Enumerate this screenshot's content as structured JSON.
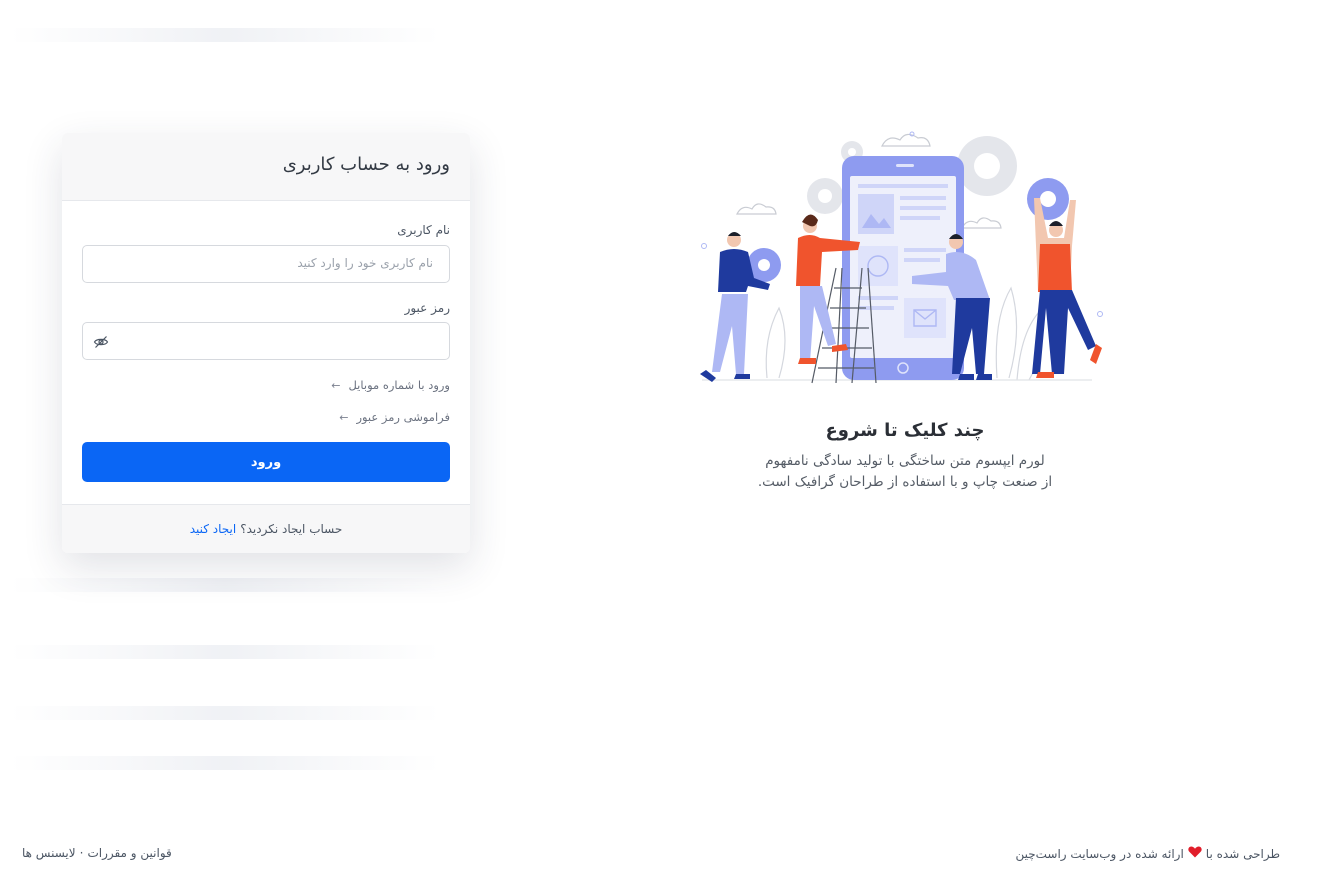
{
  "login": {
    "title": "ورود به حساب کاربری",
    "username_label": "نام کاربری",
    "username_placeholder": "نام کاربری خود را وارد کنید",
    "password_label": "رمز عبور",
    "password_value": "",
    "mobile_login": "ورود با شماره موبایل",
    "forgot_password": "فراموشی رمز عبور",
    "submit_label": "ورود",
    "no_account": "حساب ایجاد نکردید؟",
    "create_link": "ایجاد کنید"
  },
  "promo": {
    "heading": "چند کلیک تا شروع",
    "line1": "لورم ایپسوم متن ساختگی با تولید سادگی نامفهوم",
    "line2": "از صنعت چاپ و با استفاده از طراحان گرافیک است."
  },
  "footer": {
    "designed_prefix": "طراحی شده با",
    "designed_suffix": "ارائه شده در وب‌سایت راست‌چین",
    "terms": "قوانین و مقررات",
    "separator": "·",
    "licenses": "لایسنس ها"
  },
  "colors": {
    "primary": "#0a66f5",
    "accent_orange": "#f0542d",
    "illustration_blue": "#8e9bf0",
    "navy": "#1f3a9e",
    "heart": "#e11d2a"
  },
  "icons": {
    "password_toggle": "eye-off-icon",
    "link_arrow": "arrow-left-icon",
    "heart": "heart-icon"
  }
}
